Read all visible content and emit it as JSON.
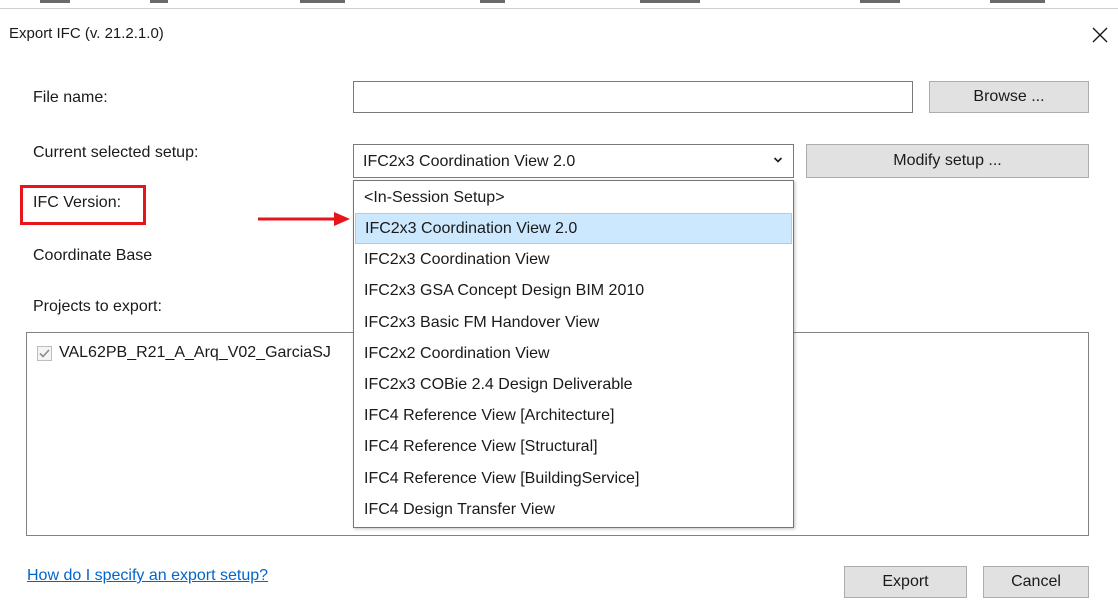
{
  "dialog": {
    "title": "Export IFC (v. 21.2.1.0)",
    "close_icon": "close-icon"
  },
  "form": {
    "file_name_label": "File name:",
    "file_name_value": "",
    "browse_label": "Browse ...",
    "setup_label": "Current selected setup:",
    "setup_value": "IFC2x3 Coordination View 2.0",
    "modify_label": "Modify setup ...",
    "ifc_version_label": "IFC Version:",
    "coordinate_base_label": "Coordinate Base",
    "projects_label": "Projects to export:"
  },
  "projects": [
    {
      "name": "VAL62PB_R21_A_Arq_V02_GarciaSJ",
      "checked": true
    }
  ],
  "dropdown": {
    "selected_index": 1,
    "options": [
      "<In-Session Setup>",
      "IFC2x3 Coordination View 2.0",
      "IFC2x3 Coordination View",
      "IFC2x3 GSA Concept Design BIM 2010",
      "IFC2x3 Basic FM Handover View",
      "IFC2x2 Coordination View",
      "IFC2x3 COBie 2.4 Design Deliverable",
      "IFC4 Reference View [Architecture]",
      "IFC4 Reference View [Structural]",
      "IFC4 Reference View [BuildingService]",
      "IFC4 Design Transfer View"
    ]
  },
  "footer": {
    "help_link": "How do I specify an export setup?",
    "export_label": "Export",
    "cancel_label": "Cancel"
  },
  "annotations": {
    "highlight_color": "#e8141c"
  },
  "colors": {
    "selection_bg": "#cce8ff",
    "selection_border": "#99d1ff",
    "link": "#0066cc",
    "button_bg": "#e1e1e1"
  }
}
